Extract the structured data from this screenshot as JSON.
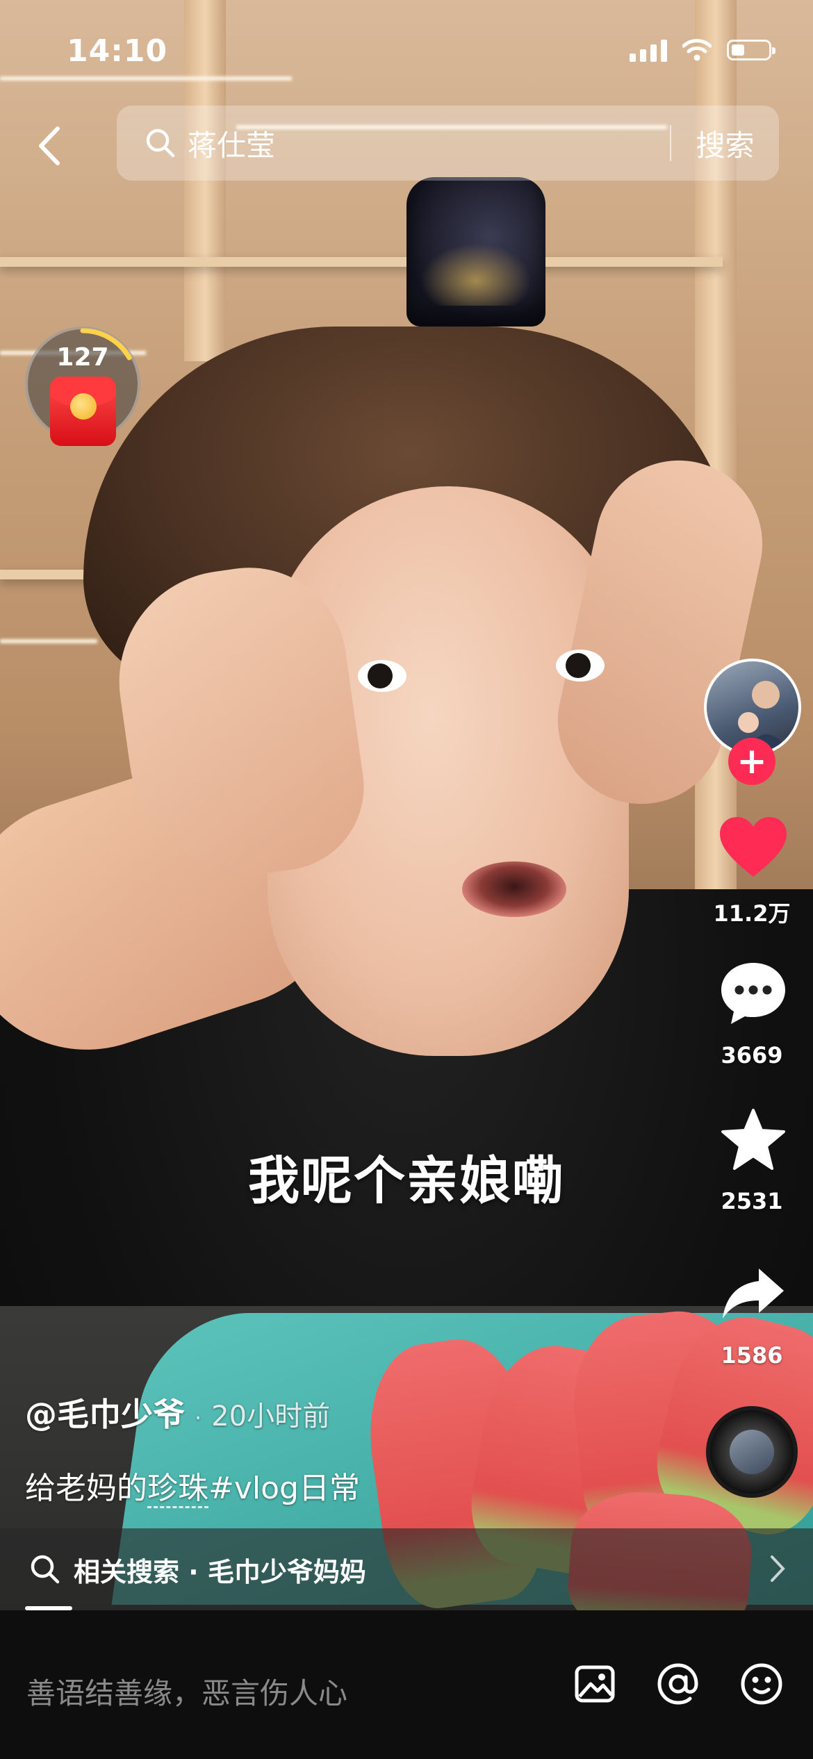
{
  "status_bar": {
    "time": "14:10"
  },
  "search": {
    "query": "蒋仕莹",
    "button_label": "搜索"
  },
  "red_packet": {
    "count": "127"
  },
  "actions": {
    "likes": "11.2万",
    "comments": "3669",
    "favorites": "2531",
    "shares": "1586"
  },
  "video": {
    "subtitle": "我呢个亲娘嘞"
  },
  "post": {
    "author": "@毛巾少爷",
    "separator": "·",
    "time_ago": "20小时前",
    "desc_prefix": "给老妈的",
    "desc_link": "珍珠",
    "desc_tag": "#vlog日常"
  },
  "related_search": {
    "label": "相关搜索",
    "separator": "·",
    "term": "毛巾少爷妈妈"
  },
  "comment_bar": {
    "placeholder": "善语结善缘，恶言伤人心"
  },
  "colors": {
    "like_red": "#fe2c55",
    "follow_red": "#fe2c55"
  },
  "icons": [
    "back-icon",
    "search-icon",
    "red-packet-icon",
    "plus-icon",
    "heart-icon",
    "comment-icon",
    "star-icon",
    "share-icon",
    "chevron-right-icon",
    "image-icon",
    "at-icon",
    "emoji-icon"
  ]
}
